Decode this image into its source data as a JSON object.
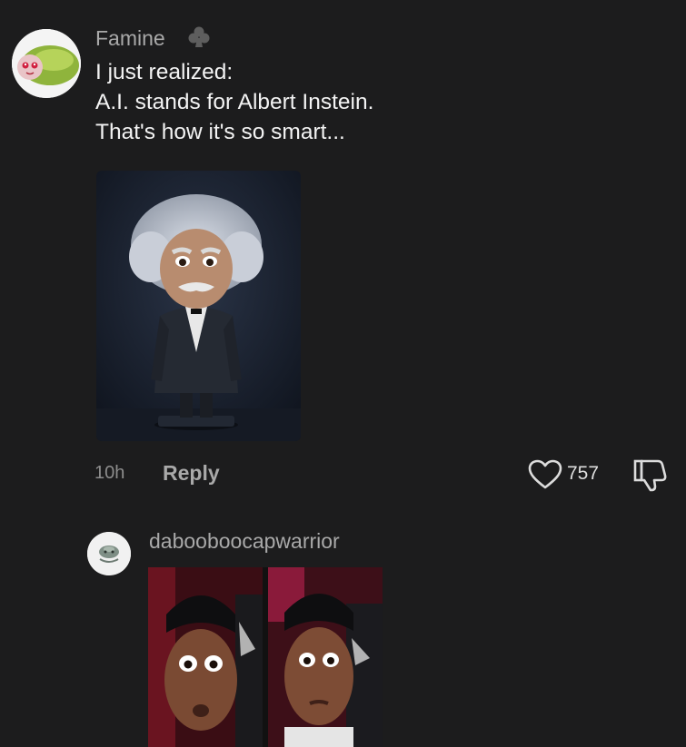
{
  "comments": [
    {
      "username": "Famine",
      "badge_icon": "club-icon",
      "lines": [
        "I just realized:",
        "A.I. stands for Albert Instein.",
        "That's how it's so smart..."
      ],
      "image_icon": "figurine-image",
      "time": "10h",
      "reply_label": "Reply",
      "likes": "757",
      "like_icon": "heart-icon",
      "dislike_icon": "thumbs-down-icon"
    },
    {
      "username": "dabooboocapwarrior",
      "image_icon": "reaction-meme-image"
    }
  ],
  "colors": {
    "background": "#1c1c1d",
    "username": "#a9a9a9",
    "comment_text": "#f3f3f3",
    "meta": "#8d8d8d"
  }
}
